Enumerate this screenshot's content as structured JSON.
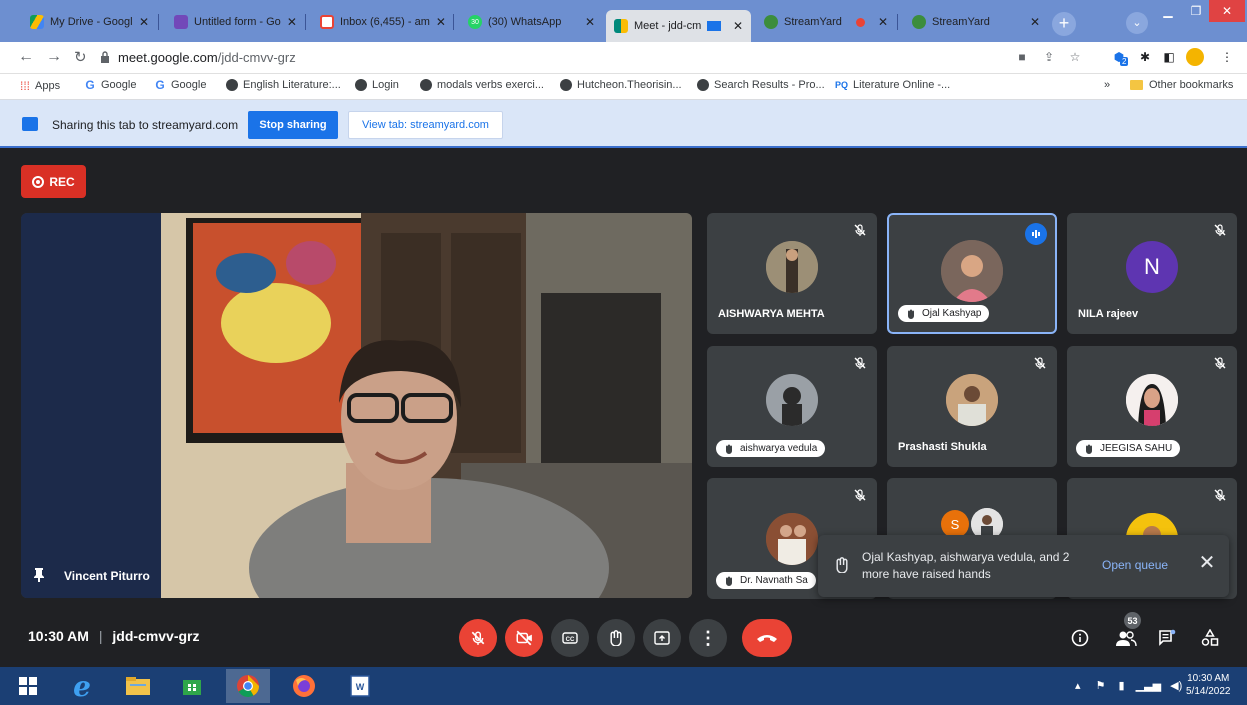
{
  "browser": {
    "tabs": [
      {
        "title": "My Drive - Googl",
        "color": "#fbbc04"
      },
      {
        "title": "Untitled form - Go",
        "color": "#7248b9"
      },
      {
        "title": "Inbox (6,455) - am",
        "color": "#ea4335"
      },
      {
        "title": "(30) WhatsApp",
        "color": "#25d366"
      },
      {
        "title": "Meet - jdd-cm",
        "color": "#00897b"
      },
      {
        "title": "StreamYard",
        "color": "#3c8d3c"
      },
      {
        "title": "StreamYard",
        "color": "#3c8d3c"
      }
    ],
    "whatsapp_badge": "30",
    "new_tab": "+",
    "url_host": "meet.google.com",
    "url_path": "/jdd-cmvv-grz",
    "extension_badge": "2",
    "bookmarks": [
      "Apps",
      "Google",
      "Google",
      "English Literature:...",
      "Login",
      "modals verbs exerci...",
      "Hutcheon.Theorisin...",
      "Search Results - Pro...",
      "Literature Online -..."
    ],
    "bookmarks_more": "»",
    "other_bookmarks": "Other bookmarks"
  },
  "sharebar": {
    "text": "Sharing this tab to streamyard.com",
    "stop_label": "Stop sharing",
    "view_label": "View tab: streamyard.com"
  },
  "meet": {
    "rec_label": "REC",
    "main_speaker": "Vincent Piturro",
    "tiles": [
      {
        "name": "AISHWARYA MEHTA",
        "pill": false
      },
      {
        "name": "Ojal Kashyap",
        "pill": true
      },
      {
        "name": "NILA rajeev",
        "pill": false,
        "initial": "N"
      },
      {
        "name": "aishwarya vedula",
        "pill": true
      },
      {
        "name": "Prashasti Shukla",
        "pill": false
      },
      {
        "name": "JEEGISA SAHU",
        "pill": true
      },
      {
        "name": "Dr. Navnath Sa",
        "pill": true
      },
      {
        "name": "",
        "pill": false,
        "initial": "S"
      },
      {
        "name": "",
        "pill": false
      }
    ],
    "toast": {
      "text": "Ojal Kashyap, aishwarya vedula, and 2 more have raised hands",
      "link": "Open queue",
      "close": "✕"
    },
    "time": "10:30 AM",
    "separator": "|",
    "meeting_code": "jdd-cmvv-grz",
    "participants_count": "53",
    "colors": {
      "red": "#ea4335",
      "nila_avatar": "#5e35b1",
      "s_avatar": "#e8710a"
    }
  },
  "taskbar": {
    "time": "10:30 AM",
    "date": "5/14/2022"
  }
}
